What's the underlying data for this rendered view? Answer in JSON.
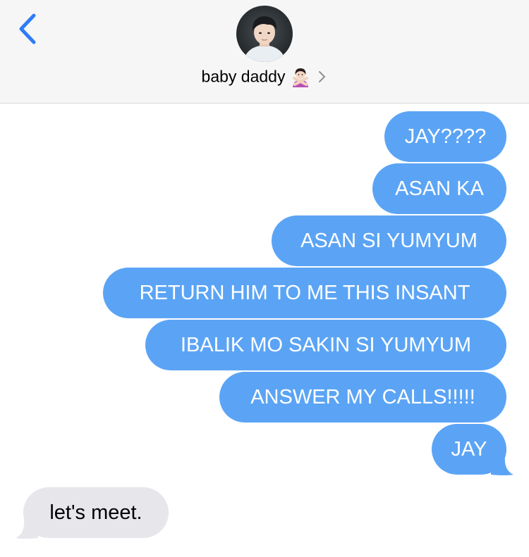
{
  "header": {
    "contact_name": "baby daddy",
    "contact_emoji": "person-gesturing-no-emoji"
  },
  "colors": {
    "sent_bubble": "#5ba4f5",
    "received_bubble": "#e6e6eb",
    "accent": "#2f7cf6",
    "header_bg": "#f6f6f6"
  },
  "messages": [
    {
      "direction": "sent",
      "text": "JAY????"
    },
    {
      "direction": "sent",
      "text": "ASAN KA"
    },
    {
      "direction": "sent",
      "text": "ASAN SI YUMYUM"
    },
    {
      "direction": "sent",
      "text": "RETURN HIM TO ME THIS INSANT"
    },
    {
      "direction": "sent",
      "text": "IBALIK MO SAKIN SI YUMYUM"
    },
    {
      "direction": "sent",
      "text": "ANSWER MY CALLS!!!!!"
    },
    {
      "direction": "sent",
      "text": "JAY"
    },
    {
      "direction": "received",
      "text": "let's meet."
    }
  ]
}
